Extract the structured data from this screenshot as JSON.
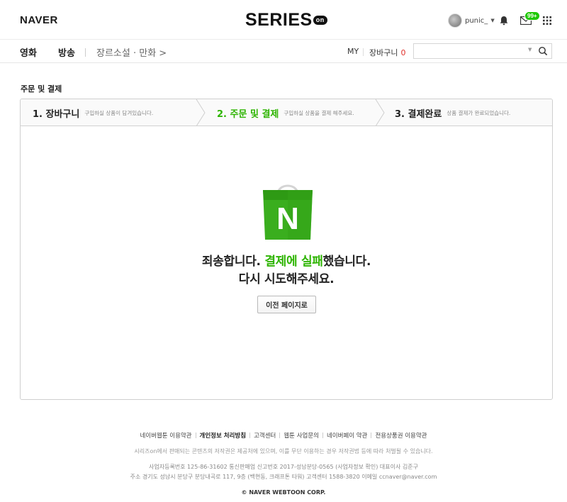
{
  "header": {
    "naver_logo": "NAVER",
    "series_logo": "SERIES",
    "series_logo_on": "on",
    "user_name": "punic_",
    "mail_badge": "99+"
  },
  "nav": {
    "movie": "영화",
    "broadcast": "방송",
    "genre_link": "장르소설 · 만화 >",
    "my": "MY",
    "cart": "장바구니",
    "cart_count": "0",
    "search_value": ""
  },
  "page": {
    "title": "주문 및 결제"
  },
  "steps": [
    {
      "title": "1. 장바구니",
      "desc": "구입하실 상품이 담겨있습니다."
    },
    {
      "title": "2. 주문 및 결제",
      "desc": "구입하실 상품을 결제 해주세요."
    },
    {
      "title": "3. 결제완료",
      "desc": "상품 결제가 완료되었습니다."
    }
  ],
  "message": {
    "line1_prefix": "죄송합니다. ",
    "line1_highlight": "결제에 실패",
    "line1_suffix": "했습니다.",
    "line2": "다시 시도해주세요.",
    "back_button": "이전 페이지로",
    "bag_letter": "N"
  },
  "footer": {
    "links": [
      "네이버웹툰 이용약관",
      "개인정보 처리방침",
      "고객센터",
      "웹툰 사업문의",
      "네이버페이 약관",
      "전용상품권 이용약관"
    ],
    "notice": "시리즈on에서 판매되는 콘텐츠의 저작권은 제공처에 있으며, 이를 무단 이용하는 경우 저작권법 등에 따라 처벌될 수 있습니다.",
    "biz_line1": "사업자등록번호 125-86-31602  통신판매업 신고번호 2017-성남분당-0565 (사업자정보 확인)  대표이사 김준구",
    "biz_line2": "주소 경기도 성남시 분당구 분당내곡로 117, 9층 (백현동, 크래프톤 타워)  고객센터 1588-3820  이메일 ccnaver@naver.com",
    "copyright": "© NAVER WEBTOON CORP."
  },
  "colors": {
    "accent_green": "#2db400",
    "cart_count_red": "#e0302a",
    "badge_green": "#1ec800"
  },
  "icons": {
    "bell": "bell-icon",
    "mail": "mail-icon",
    "apps": "apps-grid-icon",
    "search": "search-icon",
    "bag": "naver-shopping-bag-icon"
  }
}
